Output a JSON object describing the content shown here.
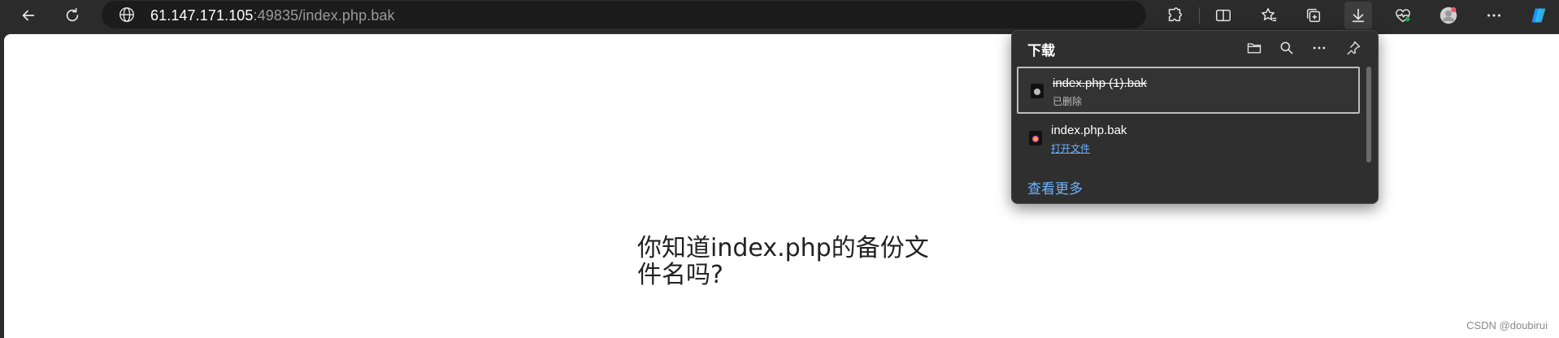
{
  "browser": {
    "url_host": "61.147.171.105",
    "url_rest": ":49835/index.php.bak"
  },
  "page": {
    "text": "你知道index.php的备份文件名吗?",
    "watermark": "CSDN @doubirui"
  },
  "downloads": {
    "title": "下载",
    "items": [
      {
        "name": "index.php (1).bak",
        "status": "已删除",
        "deleted": true
      },
      {
        "name": "index.php.bak",
        "status": "打开文件",
        "deleted": false
      }
    ],
    "see_more": "查看更多"
  },
  "icons": {
    "back": "back-arrow-icon",
    "refresh": "refresh-icon",
    "site_info": "globe-icon",
    "extensions": "puzzle-icon",
    "split_screen": "split-screen-icon",
    "favorites": "favorites-icon",
    "collections": "collections-icon",
    "downloads": "download-icon",
    "browser_essentials": "heart-pulse-icon",
    "profile": "profile-avatar-icon",
    "more": "more-icon",
    "copilot": "copilot-icon",
    "open_folder": "folder-icon",
    "search": "search-icon",
    "pin": "pin-icon"
  },
  "colors": {
    "toolbar_bg": "#2b2b2b",
    "link": "#6cb4ff",
    "flyout_bg": "#2f2f2f"
  }
}
